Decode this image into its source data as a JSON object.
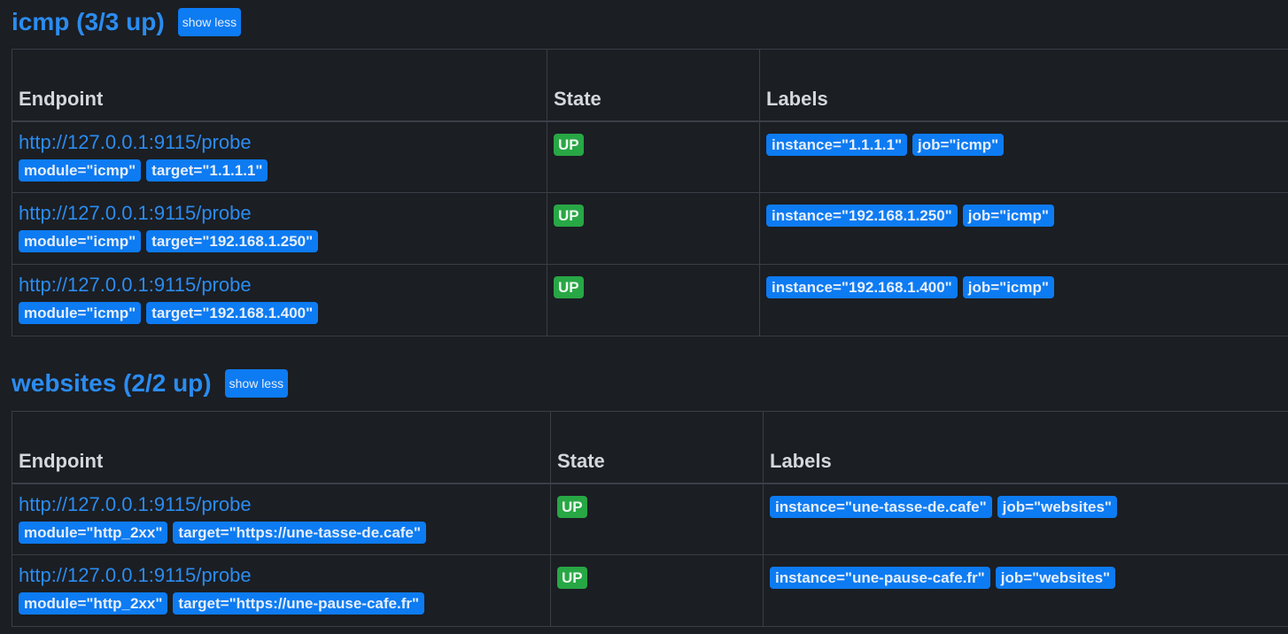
{
  "pools": [
    {
      "title": "icmp (3/3 up)",
      "toggle_label": "show less",
      "headers": {
        "endpoint": "Endpoint",
        "state": "State",
        "labels": "Labels"
      },
      "rows": [
        {
          "endpoint": "http://127.0.0.1:9115/probe",
          "params": [
            "module=\"icmp\"",
            "target=\"1.1.1.1\""
          ],
          "state": "UP",
          "labels": [
            "instance=\"1.1.1.1\"",
            "job=\"icmp\""
          ]
        },
        {
          "endpoint": "http://127.0.0.1:9115/probe",
          "params": [
            "module=\"icmp\"",
            "target=\"192.168.1.250\""
          ],
          "state": "UP",
          "labels": [
            "instance=\"192.168.1.250\"",
            "job=\"icmp\""
          ]
        },
        {
          "endpoint": "http://127.0.0.1:9115/probe",
          "params": [
            "module=\"icmp\"",
            "target=\"192.168.1.400\""
          ],
          "state": "UP",
          "labels": [
            "instance=\"192.168.1.400\"",
            "job=\"icmp\""
          ]
        }
      ]
    },
    {
      "title": "websites (2/2 up)",
      "toggle_label": "show less",
      "headers": {
        "endpoint": "Endpoint",
        "state": "State",
        "labels": "Labels"
      },
      "rows": [
        {
          "endpoint": "http://127.0.0.1:9115/probe",
          "params": [
            "module=\"http_2xx\"",
            "target=\"https://une-tasse-de.cafe\""
          ],
          "state": "UP",
          "labels": [
            "instance=\"une-tasse-de.cafe\"",
            "job=\"websites\""
          ]
        },
        {
          "endpoint": "http://127.0.0.1:9115/probe",
          "params": [
            "module=\"http_2xx\"",
            "target=\"https://une-pause-cafe.fr\""
          ],
          "state": "UP",
          "labels": [
            "instance=\"une-pause-cafe.fr\"",
            "job=\"websites\""
          ]
        }
      ]
    }
  ],
  "colors": {
    "background": "#1b1e23",
    "accent": "#0d7bf2",
    "link": "#2b8cf0",
    "state_up": "#28a745"
  }
}
